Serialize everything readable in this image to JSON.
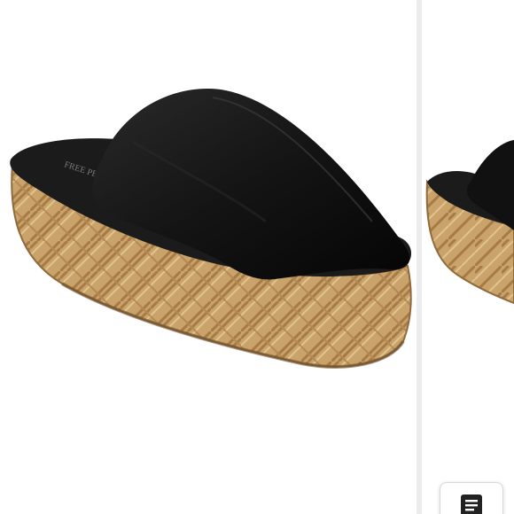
{
  "image": {
    "subject": "black-platform-slide-sandal",
    "background_color": "#ffffff",
    "colors": {
      "upper": "#141414",
      "footbed": "#1b1b1b",
      "raffia_base": "#c9a36a",
      "raffia_dark": "#9c7443",
      "raffia_light": "#e2c48e"
    }
  },
  "floating_button": {
    "icon": "menu-lines-icon"
  }
}
